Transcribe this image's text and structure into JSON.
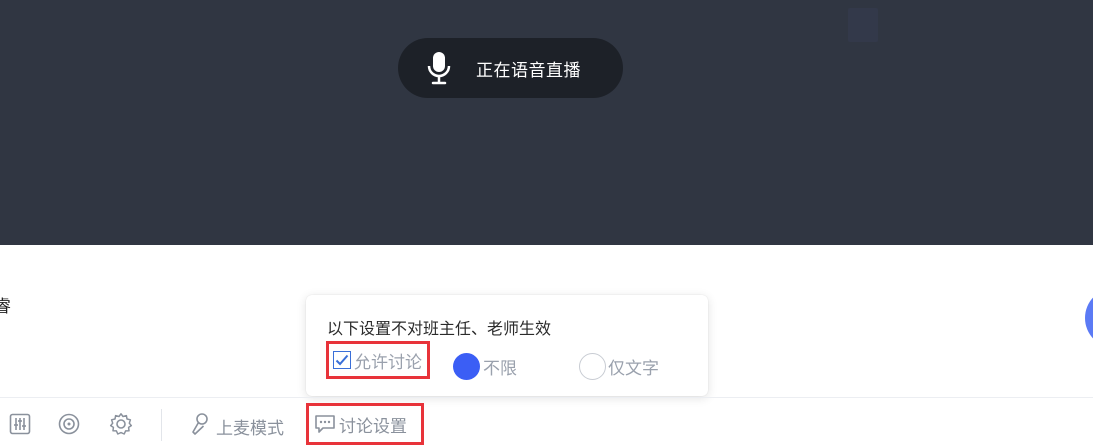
{
  "live_banner": {
    "text": "正在语音直播",
    "icon": "microphone-icon"
  },
  "side_text": "睿",
  "discussion_popover": {
    "title": "以下设置不对班主任、老师生效",
    "allow_discussion": {
      "label": "允许讨论",
      "checked": true
    },
    "options": [
      {
        "label": "不限",
        "selected": true
      },
      {
        "label": "仅文字",
        "selected": false
      }
    ]
  },
  "toolbar": {
    "icons": [
      "equalizer-icon",
      "disc-icon",
      "settings-icon"
    ],
    "mic_mode_label": "上麦模式",
    "discussion_settings_label": "讨论设置"
  },
  "colors": {
    "stage_bg": "#303642",
    "pill_bg": "#1d2128",
    "accent": "#3b5ef5",
    "highlight": "#e8333a",
    "muted_text": "#8a919c"
  }
}
